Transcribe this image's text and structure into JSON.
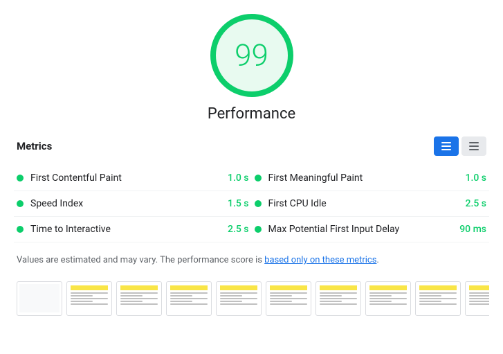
{
  "score": {
    "value": "99",
    "label": "Performance"
  },
  "metrics_section": {
    "title": "Metrics",
    "toggle": {
      "list_label": "List view",
      "grid_label": "Grid view"
    }
  },
  "metrics": [
    {
      "name": "First Contentful Paint",
      "value": "1.0 s",
      "color": "#0cce6b"
    },
    {
      "name": "First Meaningful Paint",
      "value": "1.0 s",
      "color": "#0cce6b"
    },
    {
      "name": "Speed Index",
      "value": "1.5 s",
      "color": "#0cce6b"
    },
    {
      "name": "First CPU Idle",
      "value": "2.5 s",
      "color": "#0cce6b"
    },
    {
      "name": "Time to Interactive",
      "value": "2.5 s",
      "color": "#0cce6b"
    },
    {
      "name": "Max Potential First Input Delay",
      "value": "90 ms",
      "color": "#0cce6b"
    }
  ],
  "disclaimer": {
    "text_before": "Values are estimated and may vary. The performance score is ",
    "link_text": "based only on these metrics",
    "text_after": "."
  },
  "filmstrip": {
    "frames": [
      1,
      2,
      3,
      4,
      5,
      6,
      7,
      8,
      9,
      10
    ]
  }
}
